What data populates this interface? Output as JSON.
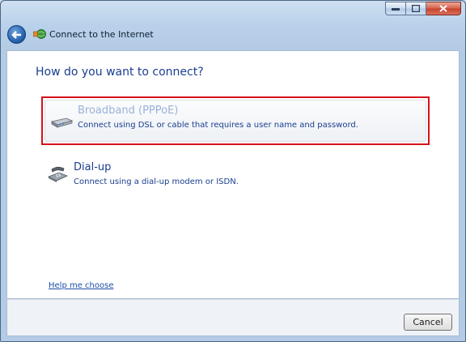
{
  "window": {
    "title": "Connect to the Internet"
  },
  "page": {
    "heading": "How do you want to connect?"
  },
  "options": [
    {
      "title": "Broadband (PPPoE)",
      "description": "Connect using DSL or cable that requires a user name and password.",
      "icon": "broadband-modem-icon"
    },
    {
      "title": "Dial-up",
      "description": "Connect using a dial-up modem or ISDN.",
      "icon": "dialup-phone-icon"
    }
  ],
  "links": {
    "help": "Help me choose"
  },
  "footer": {
    "cancel_label": "Cancel"
  },
  "colors": {
    "accent": "#1a3e8f",
    "selection_border": "#d4121a"
  }
}
